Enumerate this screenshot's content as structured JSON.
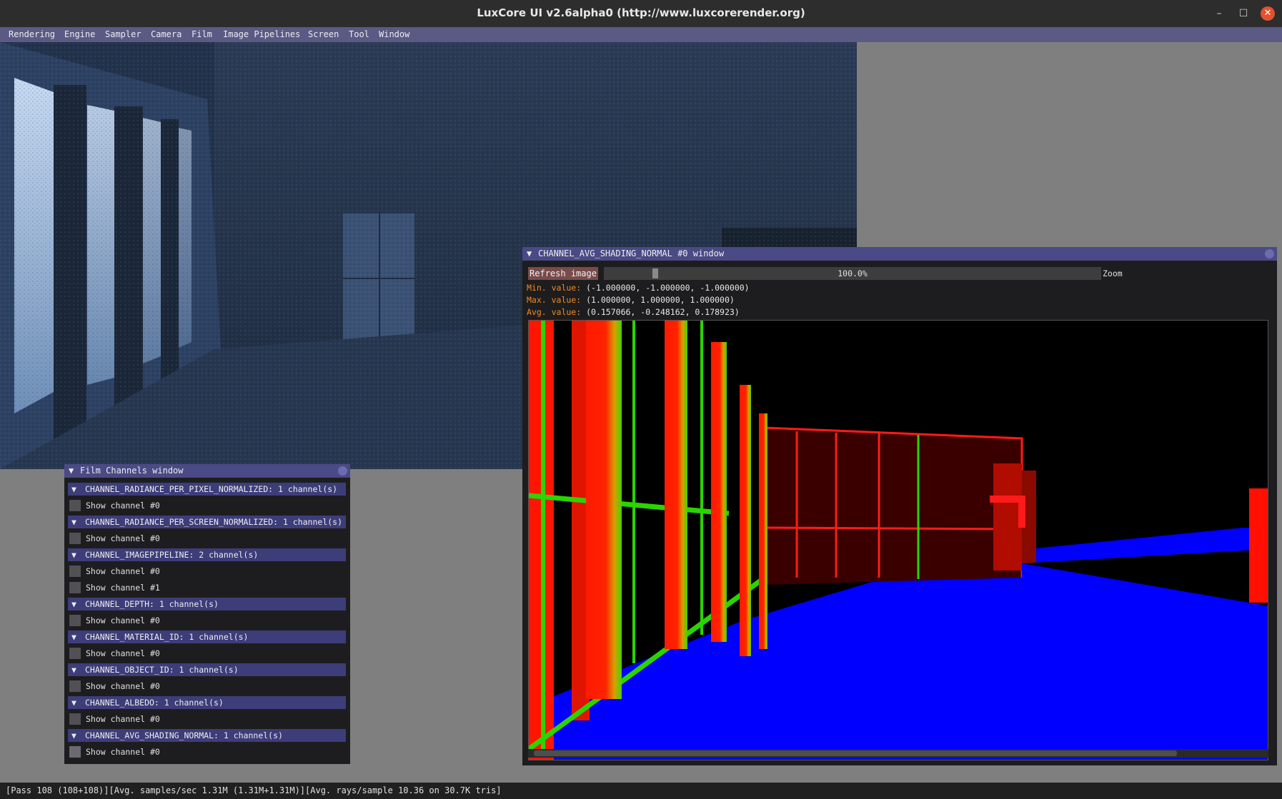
{
  "window": {
    "title": "LuxCore UI v2.6alpha0 (http://www.luxcorerender.org)",
    "minimize_glyph": "–",
    "maximize_glyph": "☐",
    "close_glyph": "✕"
  },
  "menu": [
    "Rendering",
    "Engine",
    "Sampler",
    "Camera",
    "Film",
    "Image Pipelines",
    "Screen",
    "Tool",
    "Window"
  ],
  "film_channels_window": {
    "title": "Film Channels window",
    "groups": [
      {
        "header": "CHANNEL_RADIANCE_PER_PIXEL_NORMALIZED: 1 channel(s)",
        "items": [
          "Show channel #0"
        ]
      },
      {
        "header": "CHANNEL_RADIANCE_PER_SCREEN_NORMALIZED: 1 channel(s)",
        "items": [
          "Show channel #0"
        ]
      },
      {
        "header": "CHANNEL_IMAGEPIPELINE: 2 channel(s)",
        "items": [
          "Show channel #0",
          "Show channel #1"
        ]
      },
      {
        "header": "CHANNEL_DEPTH: 1 channel(s)",
        "items": [
          "Show channel #0"
        ]
      },
      {
        "header": "CHANNEL_MATERIAL_ID: 1 channel(s)",
        "items": [
          "Show channel #0"
        ]
      },
      {
        "header": "CHANNEL_OBJECT_ID: 1 channel(s)",
        "items": [
          "Show channel #0"
        ]
      },
      {
        "header": "CHANNEL_ALBEDO: 1 channel(s)",
        "items": [
          "Show channel #0"
        ]
      },
      {
        "header": "CHANNEL_AVG_SHADING_NORMAL: 1 channel(s)",
        "items": [
          "Show channel #0"
        ]
      }
    ]
  },
  "channel_window": {
    "title": "CHANNEL_AVG_SHADING_NORMAL #0 window",
    "refresh_label": "Refresh image",
    "zoom_value": "100.0%",
    "zoom_label": "Zoom",
    "min_label": "Min. value:",
    "min_value": "(-1.000000, -1.000000, -1.000000)",
    "max_label": "Max. value:",
    "max_value": "(1.000000, 1.000000, 1.000000)",
    "avg_label": "Avg. value:",
    "avg_value": "(0.157066, -0.248162, 0.178923)"
  },
  "status_bar": "[Pass 108 (108+108)][Avg. samples/sec  1.31M (1.31M+1.31M)][Avg. rays/sample 10.36 on 30.7K tris]",
  "colors": {
    "menu_bg": "#5a5a85",
    "title_bg": "#4a4a86",
    "header_bg": "#3d3d7a",
    "accent_orange": "#f08a24"
  }
}
